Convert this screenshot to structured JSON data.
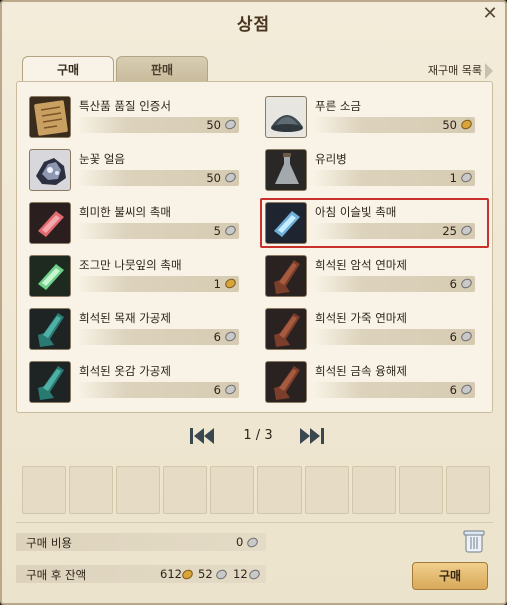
{
  "window": {
    "title": "상점"
  },
  "tabs": {
    "buy": "구매",
    "sell": "판매"
  },
  "rebuy_label": "재구매 목록",
  "items": [
    {
      "name": "특산품 품질 인증서",
      "price": "50",
      "icon": "certificate-icon"
    },
    {
      "name": "푸른 소금",
      "price": "50",
      "icon": "salt-icon"
    },
    {
      "name": "눈꽃 얼음",
      "price": "50",
      "icon": "ice-icon"
    },
    {
      "name": "유리병",
      "price": "1",
      "icon": "bottle-icon"
    },
    {
      "name": "희미한 불씨의 촉매",
      "price": "5",
      "icon": "red-crystal-icon"
    },
    {
      "name": "아침 이슬빛 촉매",
      "price": "25",
      "icon": "blue-crystal-icon"
    },
    {
      "name": "조그만 나뭇잎의 촉매",
      "price": "1",
      "icon": "green-crystal-icon"
    },
    {
      "name": "희석된 암석 연마제",
      "price": "6",
      "icon": "brown-flask-icon"
    },
    {
      "name": "희석된 목재 가공제",
      "price": "6",
      "icon": "teal-flask-icon"
    },
    {
      "name": "희석된 가죽 연마제",
      "price": "6",
      "icon": "brown-flask-icon"
    },
    {
      "name": "희석된 옷감 가공제",
      "price": "6",
      "icon": "teal-flask-icon"
    },
    {
      "name": "희석된 금속 융해제",
      "price": "6",
      "icon": "brown-flask-icon"
    }
  ],
  "pager": {
    "label": "1 / 3"
  },
  "footer": {
    "cost_label": "구매 비용",
    "cost_value": "0",
    "balance_label": "구매 후 잔액",
    "balance_gold": "612",
    "balance_silver": "52",
    "balance_copper": "12",
    "buy_button": "구매"
  },
  "colors": {
    "highlight": "#c8302c",
    "button": "#d8a95a",
    "gold_coin": "#d9a53a",
    "silver_coin": "#b5b5b5"
  }
}
